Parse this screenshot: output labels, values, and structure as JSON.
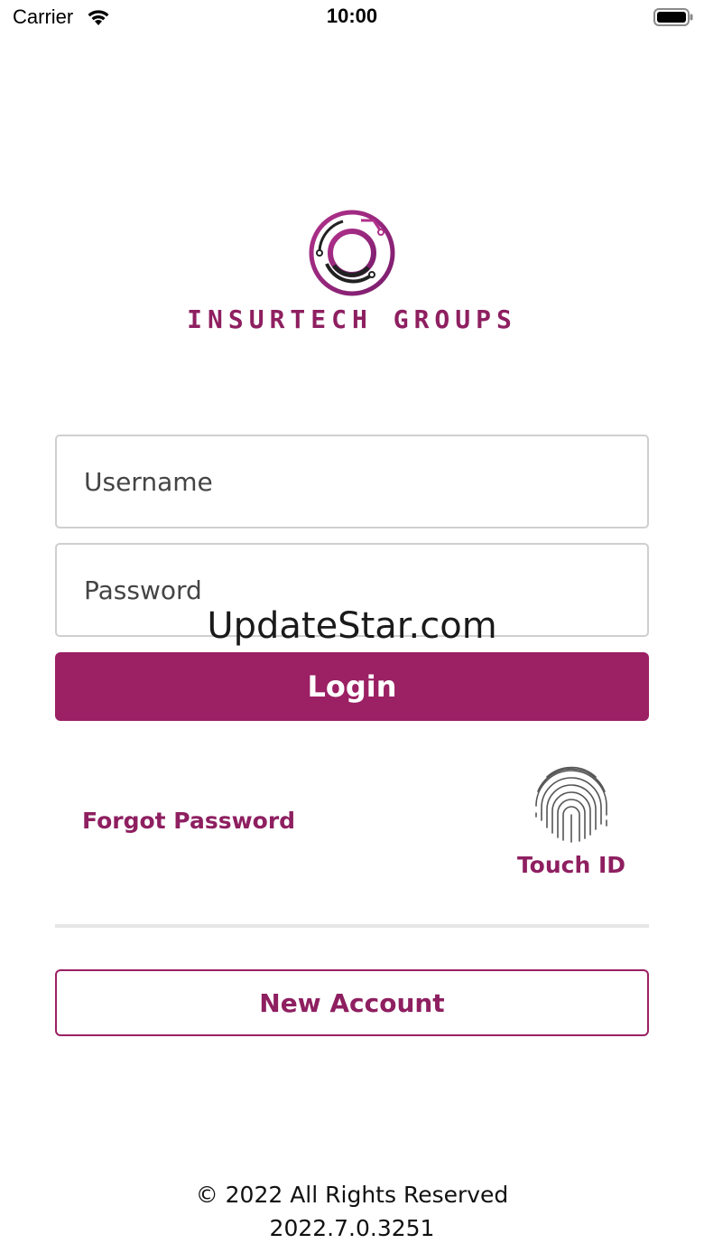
{
  "status_bar": {
    "carrier": "Carrier",
    "time": "10:00",
    "wifi_icon": "wifi-icon",
    "battery_icon": "battery-full-icon"
  },
  "brand": {
    "logo_icon": "circuit-ring-logo-icon",
    "name": "INSURTECH GROUPS",
    "primary_color": "#9b2064",
    "text_color": "#8e1f60"
  },
  "form": {
    "username_placeholder": "Username",
    "username_value": "",
    "password_placeholder": "Password",
    "password_value": "",
    "login_label": "Login"
  },
  "watermark": "UpdateStar.com",
  "links": {
    "forgot_password": "Forgot Password",
    "touch_id_label": "Touch ID",
    "touch_id_icon": "fingerprint-icon"
  },
  "new_account_label": "New Account",
  "footer": {
    "copyright": "© 2022 All Rights Reserved",
    "version": "2022.7.0.3251"
  }
}
